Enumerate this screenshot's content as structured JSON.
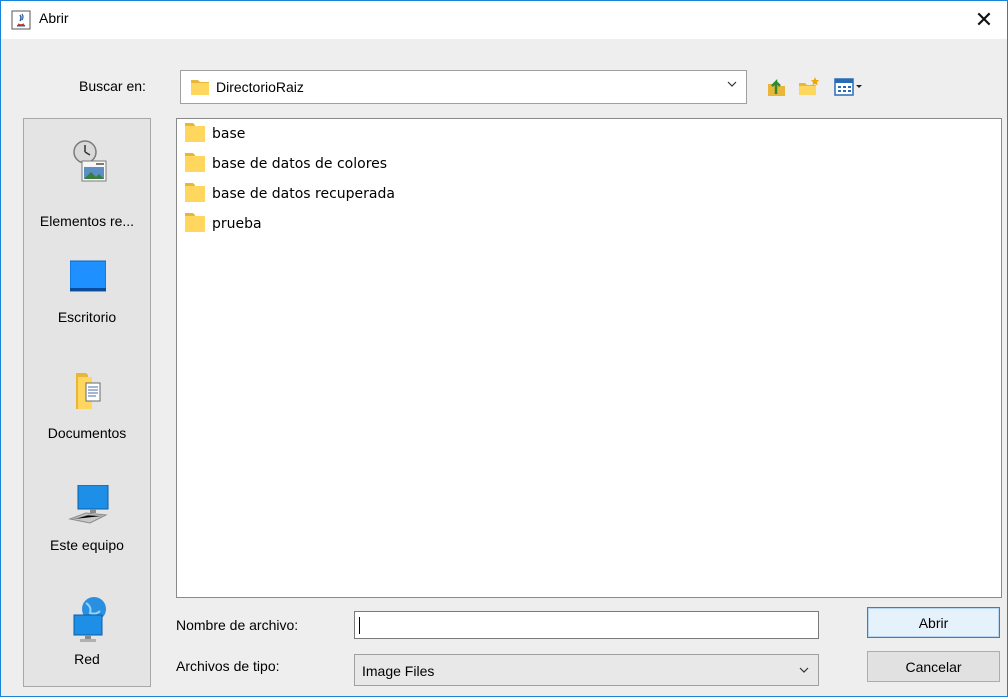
{
  "window": {
    "title": "Abrir",
    "close_glyph": "✕"
  },
  "lookin": {
    "label": "Buscar en:",
    "value": "DirectorioRaiz"
  },
  "toolbar": {
    "icons": [
      "up-one-level-icon",
      "new-folder-icon",
      "view-menu-icon"
    ]
  },
  "sidebar": {
    "items": [
      {
        "label": "Elementos re...",
        "icon": "recent-items-icon"
      },
      {
        "label": "Escritorio",
        "icon": "desktop-icon"
      },
      {
        "label": "Documentos",
        "icon": "documents-icon"
      },
      {
        "label": "Este equipo",
        "icon": "computer-icon"
      },
      {
        "label": "Red",
        "icon": "network-icon"
      }
    ]
  },
  "files": [
    {
      "name": "base"
    },
    {
      "name": "base de datos de colores"
    },
    {
      "name": "base de datos recuperada"
    },
    {
      "name": "prueba"
    }
  ],
  "filename": {
    "label": "Nombre de archivo:",
    "value": ""
  },
  "filetype": {
    "label": "Archivos de tipo:",
    "value": "Image Files"
  },
  "buttons": {
    "open": "Abrir",
    "cancel": "Cancelar"
  },
  "colors": {
    "accent": "#1883d7",
    "folder": "#ffd75e",
    "folder_dark": "#e8b73a"
  }
}
